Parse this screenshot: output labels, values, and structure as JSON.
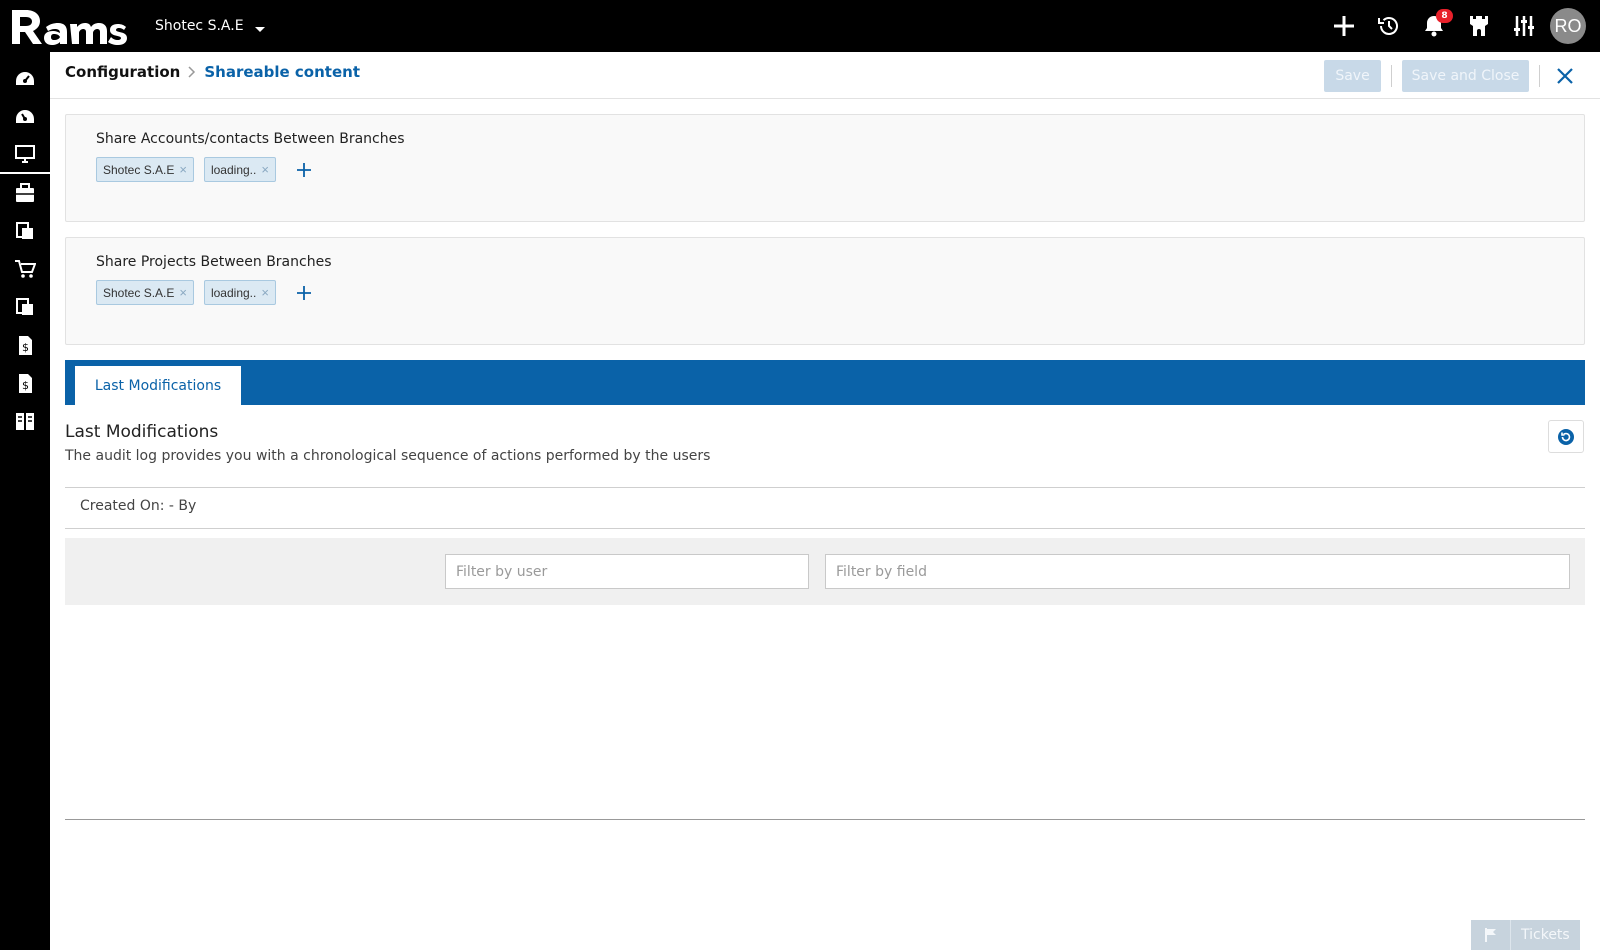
{
  "app": {
    "logo_text": "Rams",
    "company": "Shotec S.A.E",
    "notifications_count": "8",
    "user_initials": "RO"
  },
  "sidebar": {
    "items": [
      {
        "icon": "dashboard-icon"
      },
      {
        "icon": "dashboard-alt-icon"
      },
      {
        "icon": "monitor-icon",
        "active": true
      },
      {
        "icon": "briefcase-icon"
      },
      {
        "icon": "documents-icon"
      },
      {
        "icon": "cart-icon"
      },
      {
        "icon": "documents-alt-icon"
      },
      {
        "icon": "invoice-icon"
      },
      {
        "icon": "invoice-alt-icon"
      },
      {
        "icon": "columns-icon"
      }
    ]
  },
  "header": {
    "breadcrumb_root": "Configuration",
    "breadcrumb_current": "Shareable content",
    "save_label": "Save",
    "save_close_label": "Save and Close"
  },
  "panels": [
    {
      "title": "Share Accounts/contacts Between Branches",
      "tags": [
        "Shotec S.A.E",
        "loading.."
      ]
    },
    {
      "title": "Share Projects Between Branches",
      "tags": [
        "Shotec S.A.E",
        "loading.."
      ]
    }
  ],
  "tabs": [
    {
      "label": "Last Modifications",
      "active": true
    }
  ],
  "last_modifications": {
    "title": "Last Modifications",
    "description": "The audit log provides you with a chronological sequence of actions performed by the users",
    "created_text": "Created On: - By",
    "filter_user_placeholder": "Filter by user",
    "filter_field_placeholder": "Filter by field"
  },
  "tickets": {
    "label": "Tickets"
  },
  "colors": {
    "brand_blue": "#0a62a8",
    "badge_red": "#e8202a",
    "disabled_button": "#c8d9e8"
  }
}
